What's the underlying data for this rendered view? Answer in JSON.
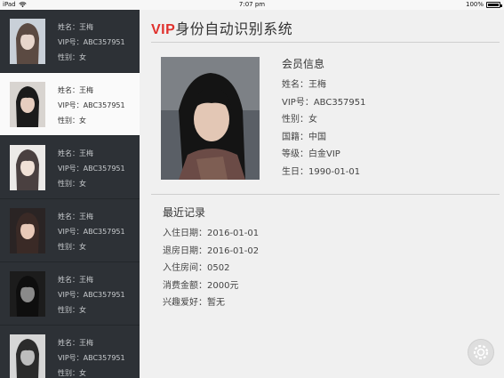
{
  "status_bar": {
    "device": "iPad",
    "time": "7:07 pm",
    "battery": "100%"
  },
  "app": {
    "title_prefix": "VIP",
    "title_rest": "身份自动识别系统"
  },
  "sidebar": {
    "items": [
      {
        "name": "姓名：王梅",
        "vip": "VIP号：ABC357951",
        "gender": "性别：女",
        "selected": false
      },
      {
        "name": "姓名：王梅",
        "vip": "VIP号：ABC357951",
        "gender": "性别：女",
        "selected": true
      },
      {
        "name": "姓名：王梅",
        "vip": "VIP号：ABC357951",
        "gender": "性别：女",
        "selected": false
      },
      {
        "name": "姓名：王梅",
        "vip": "VIP号：ABC357951",
        "gender": "性别：女",
        "selected": false
      },
      {
        "name": "姓名：王梅",
        "vip": "VIP号：ABC357951",
        "gender": "性别：女",
        "selected": false
      },
      {
        "name": "姓名：王梅",
        "vip": "VIP号：ABC357951",
        "gender": "性别：女",
        "selected": false
      }
    ]
  },
  "member_info": {
    "title": "会员信息",
    "name": "姓名：王梅",
    "vip": "VIP号：ABC357951",
    "gender": "性别：女",
    "nationality": "国籍：中国",
    "level": "等级：白金VIP",
    "birthday": "生日：1990-01-01"
  },
  "recent_records": {
    "title": "最近记录",
    "checkin": "入住日期：2016-01-01",
    "checkout": "退房日期：2016-01-02",
    "room": "入住房间：0502",
    "amount": "消费金额：2000元",
    "hobby": "兴趣爱好：暂无"
  },
  "icons": {
    "wifi": "wifi-icon",
    "battery": "battery-icon",
    "assistive_touch": "assistive-touch-icon"
  },
  "colors": {
    "sidebar_bg": "#2d3136",
    "accent_red": "#e0312d",
    "selected_bg": "#fafafa"
  }
}
